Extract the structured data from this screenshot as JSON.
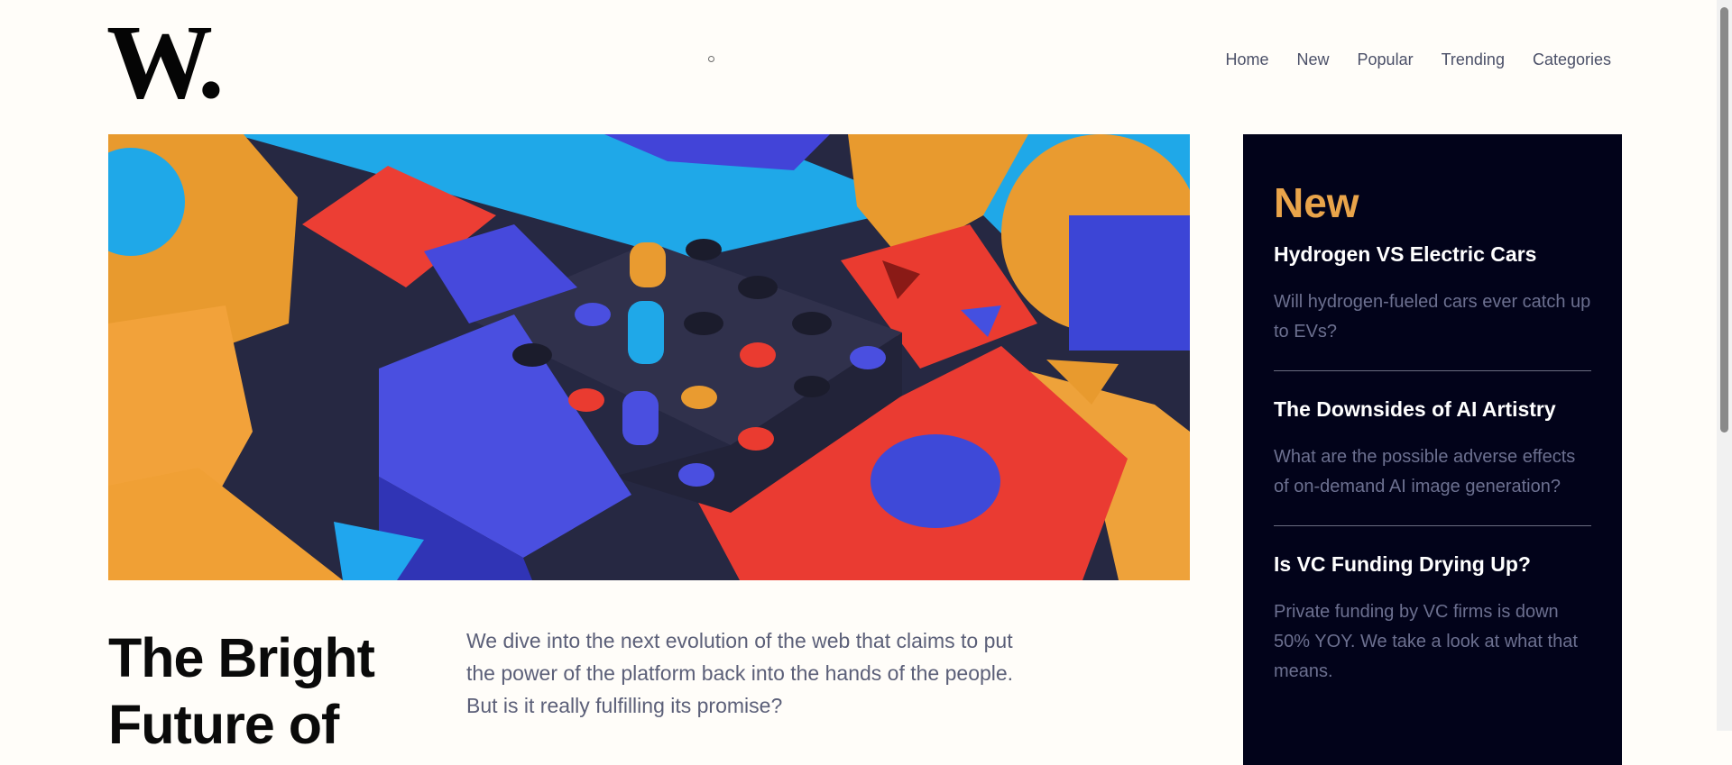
{
  "brand": {
    "logo_text": "W."
  },
  "nav": {
    "items": [
      {
        "label": "Home"
      },
      {
        "label": "New"
      },
      {
        "label": "Popular"
      },
      {
        "label": "Trending"
      },
      {
        "label": "Categories"
      }
    ]
  },
  "hero": {
    "image_icon": "abstract-3d-blocks-illustration"
  },
  "main": {
    "headline": "The Bright Future of",
    "summary": "We dive into the next evolution of the web that claims to put the power of the platform back into the hands of the people. But is it really fulfilling its promise?"
  },
  "sidebar": {
    "title": "New",
    "items": [
      {
        "title": "Hydrogen VS Electric Cars",
        "description": "Will hydrogen-fueled cars ever catch up to EVs?"
      },
      {
        "title": "The Downsides of AI Artistry",
        "description": "What are the possible adverse effects of on-demand AI image generation?"
      },
      {
        "title": "Is VC Funding Drying Up?",
        "description": "Private funding by VC firms is down 50% YOY. We take a look at what that means."
      }
    ]
  },
  "colors": {
    "background": "#fffdf9",
    "sidebar_bg": "#02031a",
    "accent": "#e9a44a",
    "text_muted": "#5b5f78"
  }
}
